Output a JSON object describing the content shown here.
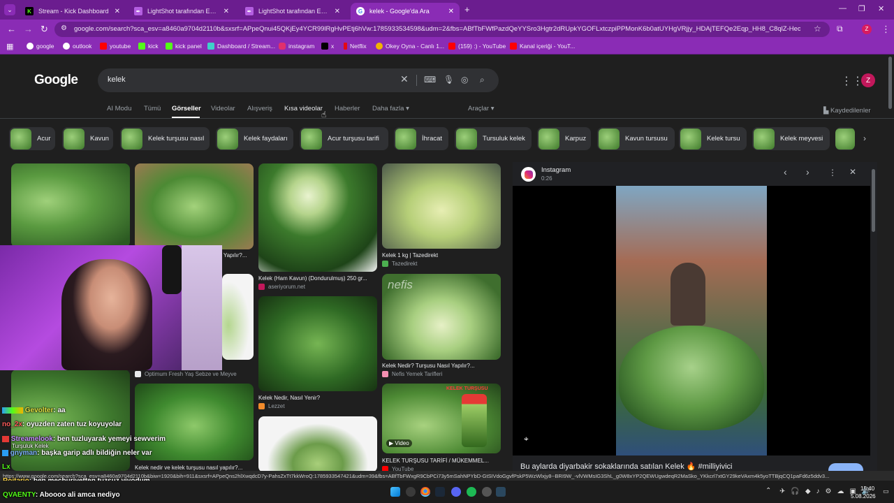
{
  "tabs": [
    {
      "label": "Stream - Kick Dashboard",
      "fav": "K",
      "color": "#53fc18"
    },
    {
      "label": "LightShot tarafından Ekran Görü",
      "fav": "",
      "color": "#b35ee0"
    },
    {
      "label": "LightShot tarafından Ekran Görü",
      "fav": "",
      "color": "#b35ee0"
    },
    {
      "label": "kelek - Google'da Ara",
      "fav": "G",
      "color": "#ffffff"
    }
  ],
  "url": "google.com/search?sca_esv=a8460a9704d2110b&sxsrf=APpeQnui45QKjEy4YCR99lRgHvPEtj6hVw:1785933534598&udm=2&fbs=ABfTbFWfPazdQeYYSro3Hgtr2dRUpkYGOFLxtczpiPPMonK6b0atUYHgVRjjy_HDAjTEFQe2Eqp_HH8_C8qlZ-HeojriixMzumZIGT...",
  "bookmarks": [
    {
      "label": "google",
      "color": "#ffffff"
    },
    {
      "label": "outlook",
      "color": "#ffffff"
    },
    {
      "label": "youtube",
      "color": "#ff0000"
    },
    {
      "label": "kick",
      "color": "#53fc18"
    },
    {
      "label": "kick panel",
      "color": "#53fc18"
    },
    {
      "label": "Dashboard / Stream...",
      "color": "#3fd0c9"
    },
    {
      "label": "instagram",
      "color": "#e1306c"
    },
    {
      "label": "x",
      "color": "#000000"
    },
    {
      "label": "Netflix",
      "color": "#e50914"
    },
    {
      "label": "Okey Oyna - Canlı 1...",
      "color": "#f2b300"
    },
    {
      "label": "(159) :) - YouTube",
      "color": "#ff0000"
    },
    {
      "label": "Kanal içeriği - YouT...",
      "color": "#ff0000"
    }
  ],
  "google": {
    "logo": "Google",
    "query": "kelek",
    "avatar": "Z",
    "nav": [
      "AI Modu",
      "Tümü",
      "Görseller",
      "Videolar",
      "Alışveriş",
      "Kısa videolar",
      "Haberler",
      "Daha fazla",
      "Araçlar"
    ],
    "saved": "Kaydedilenler",
    "chips": [
      "Acur",
      "Kavun",
      "Kelek turşusu nasıl",
      "Kelek faydaları",
      "Acur turşusu tarifi",
      "İhracat",
      "Tursuluk kelek",
      "Karpuz",
      "Kavun tursusu",
      "Kelek tursu",
      "Kelek meyvesi"
    ]
  },
  "results": {
    "col2_title": "l Yapılır?...",
    "r1_title": "Kelek (Ham Kavun) (Dondurulmuş) 250 gr...",
    "r1_source": "aseriyorum.net",
    "r2_title": "Kelek 1 kg | Tazedirekt",
    "r2_source": "Tazedirekt",
    "r3_source": "Optimum Fresh Yaş Sebze ve Meyve",
    "r4_title": "Kelek Nedir, Nasıl Yenir?",
    "r4_source": "Lezzet",
    "r5_brand": "nefis",
    "r5_title": "Kelek Nedir? Turşusu Nasıl Yapılır?...",
    "r5_source": "Nefis Yemek Tarifleri",
    "r6_title": "Kelek nedir ve kelek turşusu nasıl yapılır?...",
    "r7_badge": "Video",
    "r7_tag": "KELEK TURŞUSU",
    "r7_title": "KELEK TURŞUSU TARİFİ / MÜKEMMEL...",
    "r7_source": "YouTube"
  },
  "panel": {
    "source": "Instagram",
    "duration": "0:26",
    "caption": "Bu aylarda diyarbakir sokaklarında satılan Kelek 🔥 #milliyivici"
  },
  "chat": [
    {
      "user": "Gevolter",
      "msg": ": aa",
      "color": "#e0e040"
    },
    {
      "user": "no_2x",
      "msg": ": oyuzden zaten tuz koyuyolar",
      "color": "#ff5c5c"
    },
    {
      "user": "Streamelook",
      "msg": ": ben tuzluyarak yemeyi sewverim",
      "color": "#c58cff"
    },
    {
      "user": "Turşuluk Kelek",
      "msg": "",
      "color": "#ffffff"
    },
    {
      "user": "gnyman",
      "msg": ": başka garip adlı bildiğin neler var",
      "color": "#7fb3ff"
    },
    {
      "user": "Lx",
      "msg": "",
      "color": "#53fc18"
    },
    {
      "user": "Roitario",
      "msg": ": ben mecburiyetten tuzsuz yiyodum",
      "color": "#ffd84d"
    },
    {
      "user": "QVAENTY",
      "msg": ": Aboooo ali amca nediyo",
      "color": "#53fc18"
    }
  ],
  "status_url": "https://www.google.com/search?sca_esv=a8460a9704d2110b&biw=1920&bih=911&sxsrf=APpeQns2hlXwqdcD7y-PahsZxTt7kkWroQ:1785933547421&udm=39&fbs=ABfTbFWxgR9CbPCi73y5mSahNPYbD-GtSIVdoGgvfPskP5WzWlxjy8--BRI9W_-vlVWMsIG3ShL_g0W8xYP2QEWUgwdeqR2MaSko_YKkcrl7xtGY29keVAxm4k5yoTTBjqCQ1paFd6z5ddv3...",
  "taskbar": {
    "time": "15:40",
    "date": "5.08.2026"
  }
}
